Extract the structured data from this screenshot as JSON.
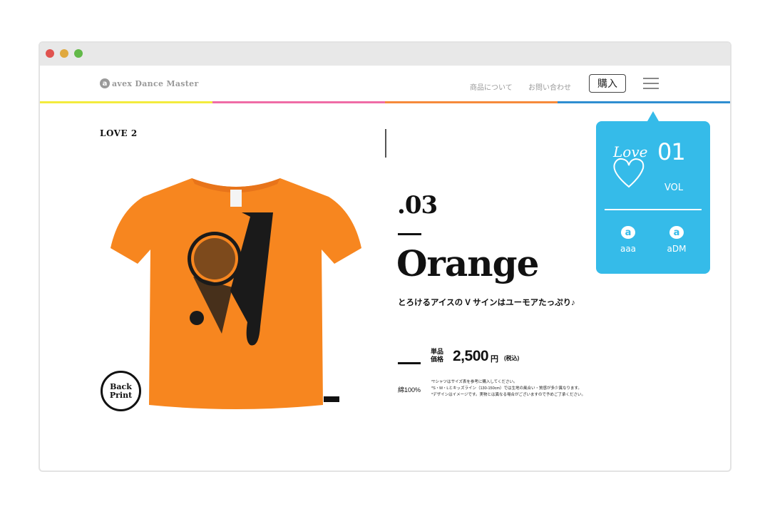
{
  "header": {
    "logo_mark": "a",
    "logo_text": "avex Dance Master",
    "nav": [
      "商品について",
      "お問い合わせ"
    ],
    "buy_label": "購入"
  },
  "colors": {
    "accent": "#35bbe9",
    "yellow": "#f3ec3e",
    "pink": "#ef6ca6",
    "orange": "#f68a3b",
    "blue": "#2f8ed1",
    "shirt": "#f7861f"
  },
  "product": {
    "collection": "LOVE 2",
    "number": ".03",
    "name": "Orange",
    "tagline": "とろけるアイスの V サインはユーモアたっぷり♪",
    "back_print": [
      "Back",
      "Print"
    ],
    "price_label_1": "単品",
    "price_label_2": "価格",
    "price": "2,500",
    "price_unit": "円",
    "tax_note": "(税込)",
    "material": "綿100%",
    "notes": [
      "*Tシャツはサイズ表を参考に購入してください。",
      "*S・M・Lとキッズライン（130-150cm）では生地の風合い・質感が多少異なります。",
      "*デザインはイメージです。実物とは異なる場合がございますので予めご了承ください。"
    ]
  },
  "side_panel": {
    "script_text": "Love",
    "vol_number": "01",
    "vol_label": "VOL",
    "buttons": [
      {
        "label": "aaa",
        "icon": "a-logo-icon"
      },
      {
        "label": "aDM",
        "icon": "a-logo-icon"
      }
    ]
  }
}
